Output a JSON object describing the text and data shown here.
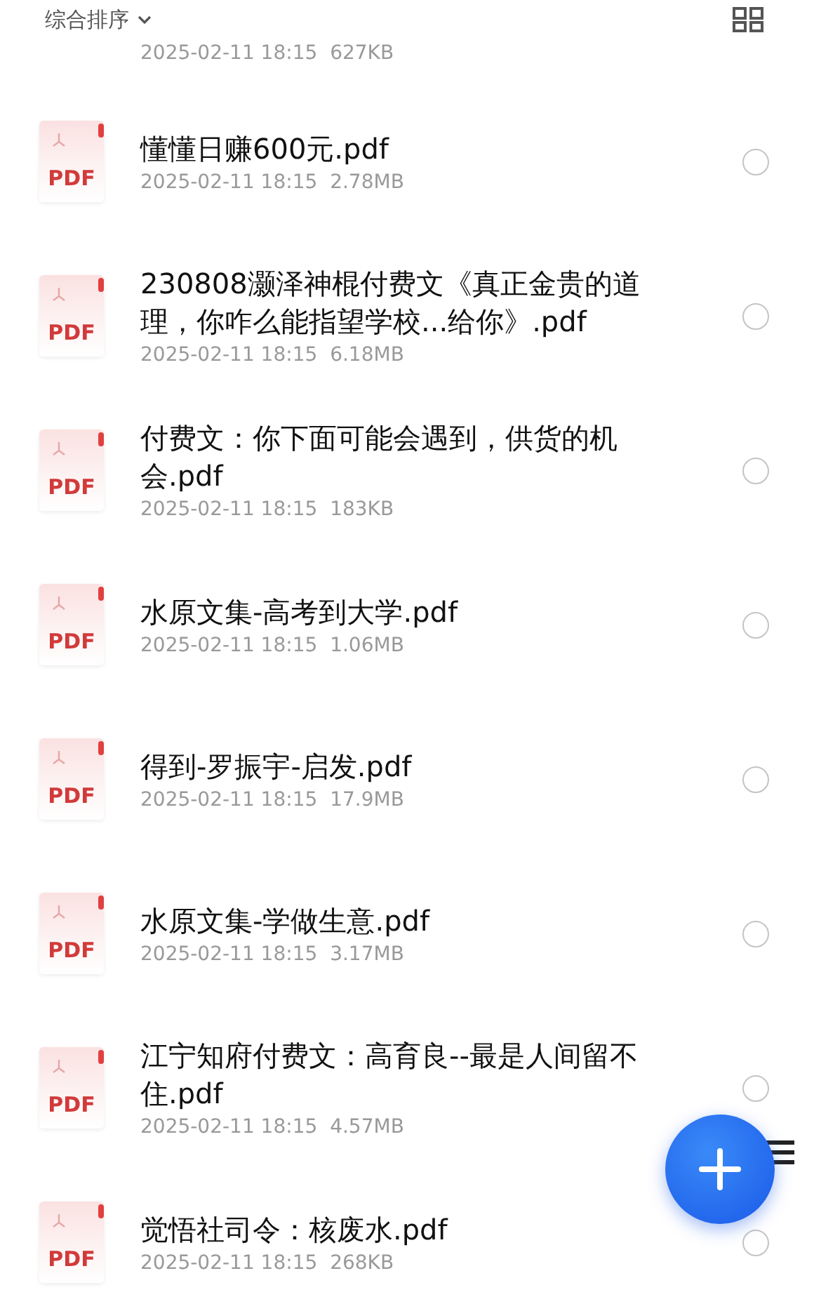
{
  "toolbar": {
    "sort_label": "综合排序"
  },
  "previous_item_meta": {
    "date": "2025-02-11 18:15",
    "size": "627KB"
  },
  "files": [
    {
      "name": "懂懂日赚600元.pdf",
      "date": "2025-02-11 18:15",
      "size": "2.78MB",
      "selected": false,
      "type_label": "PDF"
    },
    {
      "name": "230808灏泽神棍付费文《真正金贵的道理，你咋么能指望学校...给你》.pdf",
      "date": "2025-02-11 18:15",
      "size": "6.18MB",
      "selected": false,
      "type_label": "PDF"
    },
    {
      "name": "付费文：你下面可能会遇到，供货的机会.pdf",
      "date": "2025-02-11 18:15",
      "size": "183KB",
      "selected": false,
      "type_label": "PDF"
    },
    {
      "name": "水原文集-高考到大学.pdf",
      "date": "2025-02-11 18:15",
      "size": "1.06MB",
      "selected": false,
      "type_label": "PDF"
    },
    {
      "name": "得到-罗振宇-启发.pdf",
      "date": "2025-02-11 18:15",
      "size": "17.9MB",
      "selected": false,
      "type_label": "PDF"
    },
    {
      "name": "水原文集-学做生意.pdf",
      "date": "2025-02-11 18:15",
      "size": "3.17MB",
      "selected": false,
      "type_label": "PDF"
    },
    {
      "name": "江宁知府付费文：高育良--最是人间留不住.pdf",
      "date": "2025-02-11 18:15",
      "size": "4.57MB",
      "selected": false,
      "type_label": "PDF"
    },
    {
      "name": "觉悟社司令：核废水.pdf",
      "date": "2025-02-11 18:15",
      "size": "268KB",
      "selected": false,
      "type_label": "PDF"
    }
  ]
}
